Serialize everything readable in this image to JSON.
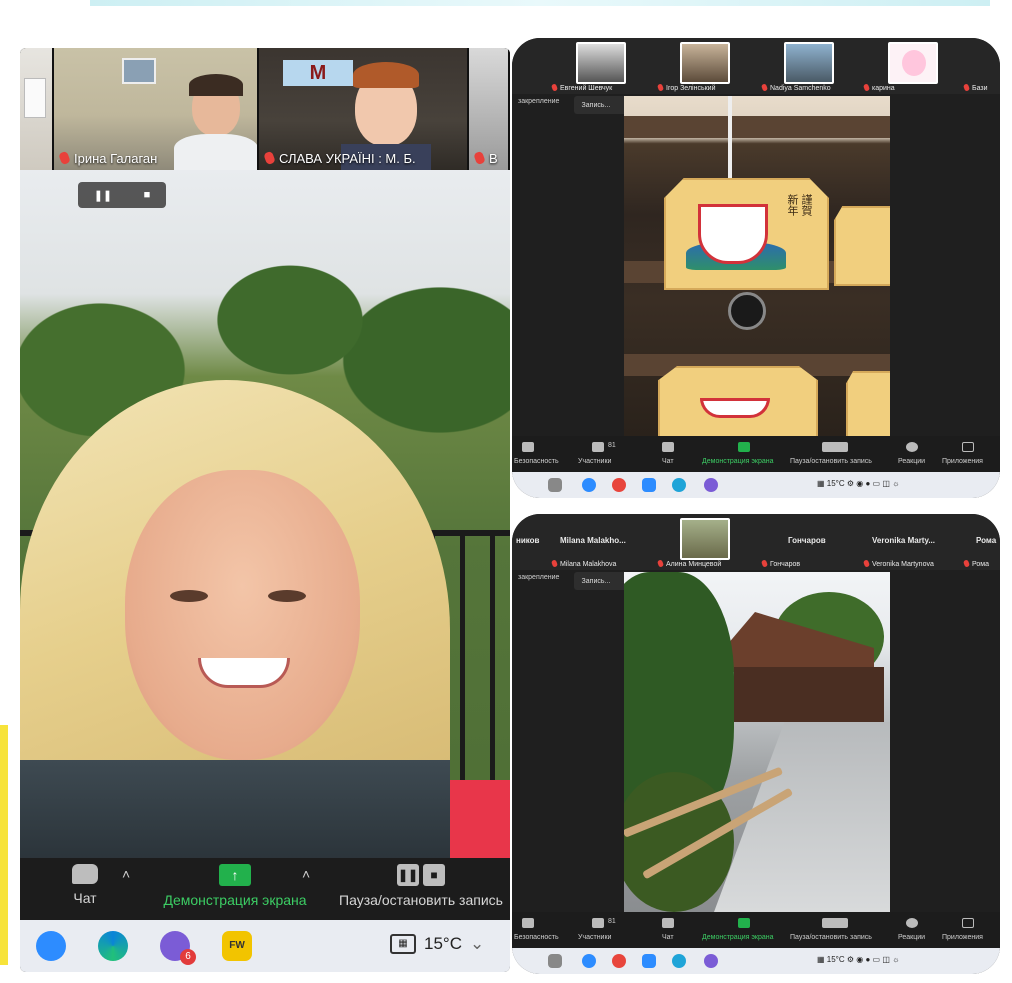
{
  "left_window": {
    "participants": [
      {
        "name": ""
      },
      {
        "name": "Ірина Галаган"
      },
      {
        "name": "СЛАВА УКРАЇНІ : М. Б."
      },
      {
        "name": "В"
      }
    ],
    "thumb3_sign": "M",
    "toolbar": {
      "chat_label": "Чат",
      "share_label": "Демонстрация экрана",
      "pause_label": "Пауза/остановить запись"
    },
    "taskbar": {
      "badge": "6",
      "temperature": "15°C",
      "zoom_icon_label": "FW"
    }
  },
  "right_top": {
    "participants": [
      "Евгений Шевчук",
      "Ігор Зелінський",
      "Nadiya Samchenko",
      "карина",
      "Бази"
    ],
    "side_label": "закрепление",
    "rec_label": "Запись...",
    "ema_text": [
      "謹賀",
      "新年"
    ],
    "toolbar": {
      "items": [
        "Безопасность",
        "Участники",
        "Чат",
        "Демонстрация экрана",
        "Пауза/остановить запись",
        "Реакции",
        "Приложения"
      ],
      "participants_count": "81"
    },
    "taskbar": {
      "temperature": "15°C"
    }
  },
  "right_bottom": {
    "top_names": [
      "ников",
      "Milana  Malakho...",
      "Гончаров",
      "Veronika  Marty...",
      "Рома"
    ],
    "participants": [
      "Milana Malakhova",
      "Алина Минцевой",
      "Гончаров",
      "Veronika Martynova",
      "Рома"
    ],
    "side_label": "закрепление",
    "rec_label": "Запись...",
    "toolbar": {
      "items": [
        "Безопасность",
        "Участники",
        "Чат",
        "Демонстрация экрана",
        "Пауза/остановить запись",
        "Реакции",
        "Приложения"
      ],
      "participants_count": "81"
    },
    "taskbar": {
      "temperature": "15°C"
    }
  },
  "colors": {
    "share_green": "#22b14c",
    "mic_muted_red": "#e8413b",
    "toolbar_bg": "#1c1c1c",
    "taskbar_bg": "#e9ecf2"
  }
}
